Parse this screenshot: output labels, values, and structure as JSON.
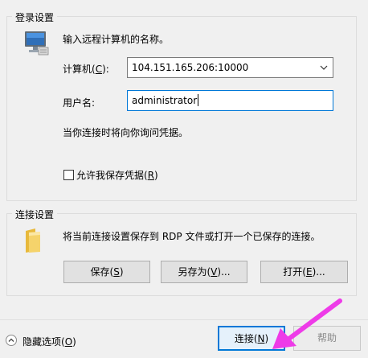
{
  "login": {
    "group_title": "登录设置",
    "intro": "输入远程计算机的名称。",
    "computer_label": "计算机(",
    "computer_key": "C",
    "computer_label_end": "):",
    "computer_value": "104.151.165.206:10000",
    "username_label": "用户名:",
    "username_value": "administrator",
    "credential_note": "当你连接时将向你询问凭据。",
    "allow_save_label": "允许我保存凭据(",
    "allow_save_key": "R",
    "allow_save_end": ")"
  },
  "connection": {
    "group_title": "连接设置",
    "description": "将当前连接设置保存到 RDP 文件或打开一个已保存的连接。",
    "save_label": "保存(",
    "save_key": "S",
    "save_end": ")",
    "saveas_label": "另存为(",
    "saveas_key": "V",
    "saveas_end": ")...",
    "open_label": "打开(",
    "open_key": "E",
    "open_end": ")..."
  },
  "footer": {
    "hide_options_label": "隐藏选项(",
    "hide_options_key": "O",
    "hide_options_end": ")",
    "connect_label": "连接(",
    "connect_key": "N",
    "connect_end": ")",
    "help_label": "帮助"
  },
  "colors": {
    "arrow": "#ee3be8",
    "focus": "#0078d7"
  },
  "icons": {
    "computer": "monitor-computer-icon",
    "folder": "folder-icon",
    "collapse": "chevron-up-icon",
    "pointer": "arrow-icon"
  }
}
